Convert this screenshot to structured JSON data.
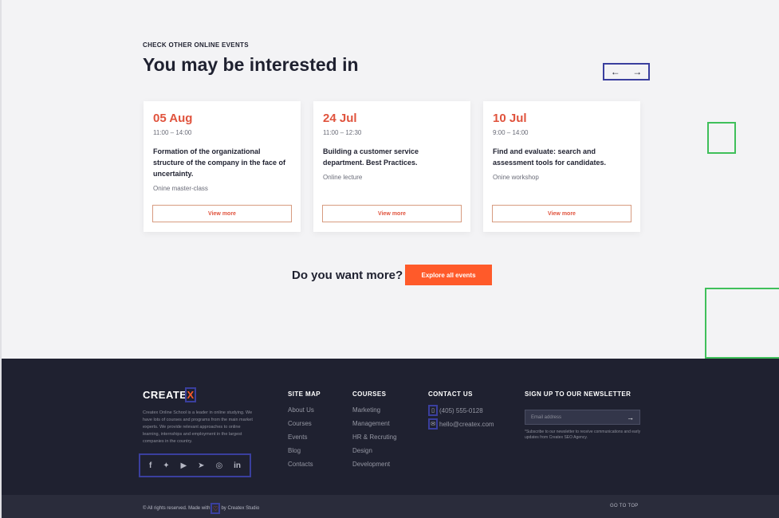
{
  "events": {
    "eyebrow": "CHECK OTHER ONLINE EVENTS",
    "headline": "You may be interested in",
    "prev_icon": "arrow-left-icon",
    "next_icon": "arrow-right-icon",
    "cards": [
      {
        "date": "05 Aug",
        "time": "11:00 – 14:00",
        "title": "Formation of the organizational structure of the company in the face of uncertainty.",
        "type": "Onine master-class",
        "button": "View more"
      },
      {
        "date": "24 Jul",
        "time": "11:00 – 12:30",
        "title": "Building a customer service department. Best Practices.",
        "type": "Online lecture",
        "button": "View more"
      },
      {
        "date": "10 Jul",
        "time": "9:00 – 14:00",
        "title": "Find and evaluate: search and assessment tools for candidates.",
        "type": "Onine workshop",
        "button": "View more"
      }
    ],
    "cta_question": "Do you want more?",
    "cta_button": "Explore all events"
  },
  "footer": {
    "logo_text": "CREATE",
    "logo_x": "X",
    "about": "Createx Online School is a leader in online studying. We have lots of courses and programs from the main market experts. We provide relevant approaches to online learning, internships and employment in the largest companies in the country.",
    "socials": [
      {
        "icon": "facebook-icon",
        "glyph": "f"
      },
      {
        "icon": "twitter-icon",
        "glyph": "🐦"
      },
      {
        "icon": "youtube-icon",
        "glyph": "▶"
      },
      {
        "icon": "telegram-icon",
        "glyph": "➤"
      },
      {
        "icon": "instagram-icon",
        "glyph": "◎"
      },
      {
        "icon": "linkedin-icon",
        "glyph": "in"
      }
    ],
    "sitemap": {
      "heading": "SITE MAP",
      "items": [
        "About Us",
        "Courses",
        "Events",
        "Blog",
        "Contacts"
      ]
    },
    "courses": {
      "heading": "COURSES",
      "items": [
        "Marketing",
        "Management",
        "HR & Recruting",
        "Design",
        "Development"
      ]
    },
    "contact": {
      "heading": "CONTACT US",
      "phone": "(405) 555-0128",
      "email": "hello@createx.com",
      "phone_icon": "phone-icon",
      "email_icon": "mail-icon"
    },
    "newsletter": {
      "heading": "SIGN UP TO OUR NEWSLETTER",
      "placeholder": "Email address",
      "note": "*Subscribe to our newsletter to receive communications and early updates from Createx SEO Agency."
    },
    "copyright_prefix": "© All rights reserved. Made with",
    "copyright_suffix": "by Createx Studio",
    "go_top": "GO TO TOP"
  },
  "colors": {
    "accent": "#ff5a2a",
    "date": "#e0533d",
    "footer_bg": "#1f2130"
  }
}
